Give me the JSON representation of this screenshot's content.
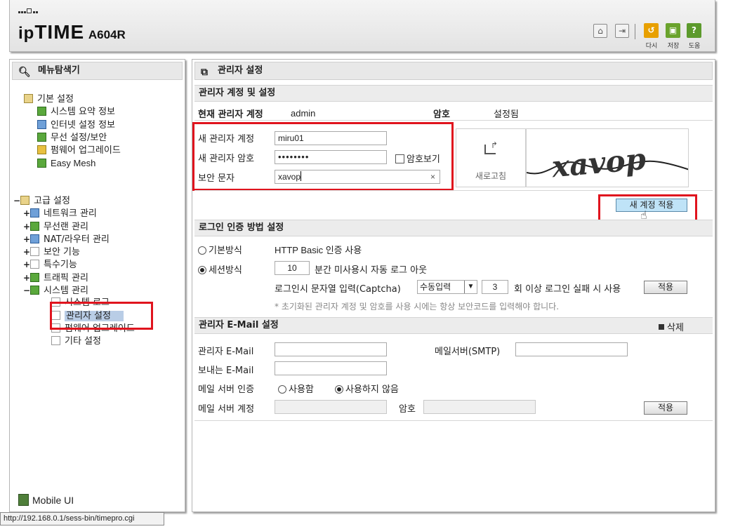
{
  "header": {
    "logo_ip": "ip",
    "logo_time": "TIME",
    "logo_model": "A604R",
    "buttons": [
      {
        "name": "home-icon"
      },
      {
        "name": "logout-icon"
      }
    ],
    "actions": {
      "redo": "다시",
      "save": "저장",
      "help": "도움"
    }
  },
  "sidebar": {
    "title": "메뉴탐색기",
    "basic": {
      "label": "기본 설정",
      "items": [
        "시스템 요약 정보",
        "인터넷 설정 정보",
        "무선 설정/보안",
        "펌웨어 업그레이드",
        "Easy Mesh"
      ]
    },
    "advanced": {
      "label": "고급 설정",
      "items": [
        "네트워크 관리",
        "무선랜 관리",
        "NAT/라우터 관리",
        "보안 기능",
        "특수기능",
        "트래픽 관리",
        "시스템 관리"
      ],
      "system_items": [
        "시스템 로그",
        "관리자 설정",
        "펌웨어 업그레이드",
        "기타 설정"
      ]
    },
    "mobile_ui": "Mobile UI"
  },
  "status_url": "http://192.168.0.1/sess-bin/timepro.cgi",
  "main": {
    "title": "관리자 설정",
    "account_section": {
      "title": "관리자 계정 및 설정",
      "current_label": "현재 관리자 계정",
      "current_value": "admin",
      "password_label": "암호",
      "password_status": "설정됨",
      "new_id_label": "새 관리자 계정",
      "new_id_value": "miru01",
      "new_pw_label": "새 관리자 암호",
      "new_pw_value": "••••••••",
      "show_pw_label": "암호보기",
      "captcha_label": "보안 문자",
      "captcha_value": "xavop",
      "clear_glyph": "×",
      "refresh_label": "새로고침",
      "captcha_image_text": "xavop",
      "apply_button": "새 계정 적용"
    },
    "login_section": {
      "title": "로그인 인증 방법 설정",
      "basic_mode_label": "기본방식",
      "basic_mode_desc": "HTTP Basic 인증 사용",
      "session_mode_label": "세션방식",
      "timeout_value": "10",
      "timeout_desc": "분간 미사용시 자동 로그 아웃",
      "captcha_desc": "로그인시 문자열 입력(Captcha)",
      "captcha_mode": "수동입력",
      "fail_count": "3",
      "fail_desc": "회 이상 로그인 실패 시 사용",
      "apply_button": "적용",
      "note": "* 초기화된 관리자 계정 및 암호를 사용 시에는 항상 보안코드를 입력해야 합니다."
    },
    "email_section": {
      "title": "관리자 E-Mail 설정",
      "delete_label": "삭제",
      "admin_email_label": "관리자 E-Mail",
      "admin_email_value": "",
      "smtp_label": "메일서버(SMTP)",
      "smtp_value": "",
      "sender_label": "보내는 E-Mail",
      "sender_value": "",
      "auth_label": "메일 서버 인증",
      "auth_use": "사용함",
      "auth_nouse": "사용하지 않음",
      "account_label": "메일 서버 계정",
      "account_value": "",
      "pw_label": "암호",
      "pw_value": "",
      "apply_button": "적용"
    }
  },
  "colors": {
    "highlight_red": "#e0141e",
    "selected_bg": "#b9cde6",
    "apply_accent_bg": "#bfe3f7"
  }
}
